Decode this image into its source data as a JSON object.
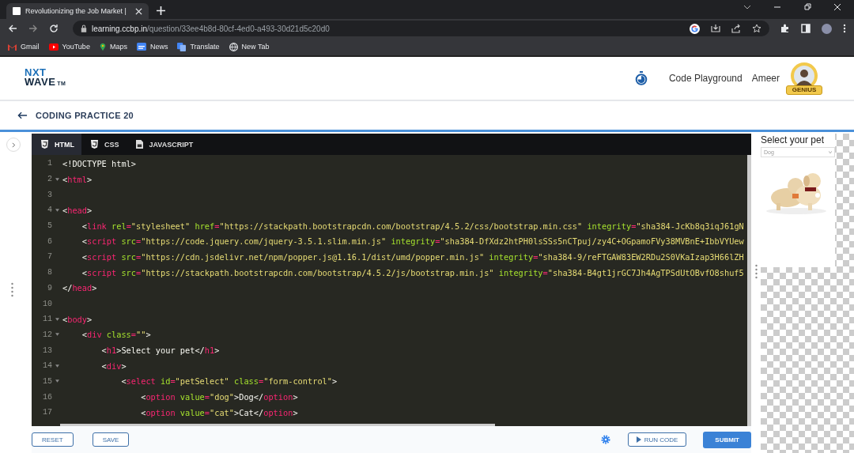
{
  "browser": {
    "tab_title": "Revolutionizing the Job Market |",
    "url_host": "learning.ccbp.in",
    "url_path": "/question/33ee4b8d-80cf-4ed0-a493-30d21d5c20d0",
    "bookmarks": [
      {
        "kind": "gmail",
        "label": "Gmail"
      },
      {
        "kind": "youtube",
        "label": "YouTube"
      },
      {
        "kind": "maps",
        "label": "Maps"
      },
      {
        "kind": "news",
        "label": "News"
      },
      {
        "kind": "translate",
        "label": "Translate"
      },
      {
        "kind": "globe",
        "label": "New Tab"
      }
    ]
  },
  "header": {
    "logo_top": "NXT",
    "logo_bottom": "WAVE",
    "logo_mark": "TM",
    "nav_link": "Code Playground",
    "user_name": "Ameer",
    "badge": "GENIUS"
  },
  "subheader": {
    "title": "CODING PRACTICE 20"
  },
  "editor": {
    "tabs": [
      {
        "label": "HTML",
        "kind": "html",
        "selected": true
      },
      {
        "label": "CSS",
        "kind": "css",
        "selected": false
      },
      {
        "label": "JAVASCRIPT",
        "kind": "js",
        "selected": false
      }
    ],
    "lines": [
      {
        "number": "1",
        "foldable": false,
        "tokens": [
          {
            "kind": "plain",
            "text": "<!DOCTYPE html>"
          }
        ]
      },
      {
        "number": "2",
        "foldable": true,
        "tokens": [
          {
            "kind": "plain",
            "text": "<"
          },
          {
            "kind": "tag",
            "text": "html"
          },
          {
            "kind": "plain",
            "text": ">"
          }
        ]
      },
      {
        "number": "3",
        "foldable": false
      },
      {
        "number": "4",
        "foldable": true,
        "tokens": [
          {
            "kind": "plain",
            "text": "<"
          },
          {
            "kind": "tag",
            "text": "head"
          },
          {
            "kind": "plain",
            "text": ">"
          }
        ]
      },
      {
        "number": "5",
        "foldable": false,
        "tokens": [
          {
            "kind": "plain",
            "text": "    <"
          },
          {
            "kind": "tag",
            "text": "link"
          },
          {
            "kind": "attr",
            "text": " rel"
          },
          {
            "kind": "eq",
            "text": "="
          },
          {
            "kind": "str",
            "text": "\"stylesheet\""
          },
          {
            "kind": "attr",
            "text": " href"
          },
          {
            "kind": "eq",
            "text": "="
          },
          {
            "kind": "str",
            "text": "\"https://stackpath.bootstrapcdn.com/bootstrap/4.5.2/css/bootstrap.min.css\""
          },
          {
            "kind": "attr",
            "text": " integrity"
          },
          {
            "kind": "eq",
            "text": "="
          },
          {
            "kind": "str",
            "text": "\"sha384-JcKb8q3iqJ61gN"
          }
        ]
      },
      {
        "number": "6",
        "foldable": false,
        "tokens": [
          {
            "kind": "plain",
            "text": "    <"
          },
          {
            "kind": "tag",
            "text": "script"
          },
          {
            "kind": "attr",
            "text": " src"
          },
          {
            "kind": "eq",
            "text": "="
          },
          {
            "kind": "str",
            "text": "\"https://code.jquery.com/jquery-3.5.1.slim.min.js\""
          },
          {
            "kind": "attr",
            "text": " integrity"
          },
          {
            "kind": "eq",
            "text": "="
          },
          {
            "kind": "str",
            "text": "\"sha384-DfXdz2htPH0lsSSs5nCTpuj/zy4C+OGpamoFVy38MVBnE+IbbVYUew"
          }
        ]
      },
      {
        "number": "7",
        "foldable": false,
        "tokens": [
          {
            "kind": "plain",
            "text": "    <"
          },
          {
            "kind": "tag",
            "text": "script"
          },
          {
            "kind": "attr",
            "text": " src"
          },
          {
            "kind": "eq",
            "text": "="
          },
          {
            "kind": "str",
            "text": "\"https://cdn.jsdelivr.net/npm/popper.js@1.16.1/dist/umd/popper.min.js\""
          },
          {
            "kind": "attr",
            "text": " integrity"
          },
          {
            "kind": "eq",
            "text": "="
          },
          {
            "kind": "str",
            "text": "\"sha384-9/reFTGAW83EW2RDu2S0VKaIzap3H66lZH"
          }
        ]
      },
      {
        "number": "8",
        "foldable": false,
        "tokens": [
          {
            "kind": "plain",
            "text": "    <"
          },
          {
            "kind": "tag",
            "text": "script"
          },
          {
            "kind": "attr",
            "text": " src"
          },
          {
            "kind": "eq",
            "text": "="
          },
          {
            "kind": "str",
            "text": "\"https://stackpath.bootstrapcdn.com/bootstrap/4.5.2/js/bootstrap.min.js\""
          },
          {
            "kind": "attr",
            "text": " integrity"
          },
          {
            "kind": "eq",
            "text": "="
          },
          {
            "kind": "str",
            "text": "\"sha384-B4gt1jrGC7Jh4AgTPSdUtOBvfO8shuf5"
          }
        ]
      },
      {
        "number": "9",
        "foldable": false,
        "tokens": [
          {
            "kind": "plain",
            "text": "</"
          },
          {
            "kind": "tag",
            "text": "head"
          },
          {
            "kind": "plain",
            "text": ">"
          }
        ]
      },
      {
        "number": "10",
        "foldable": false
      },
      {
        "number": "11",
        "foldable": true,
        "tokens": [
          {
            "kind": "plain",
            "text": "<"
          },
          {
            "kind": "tag",
            "text": "body"
          },
          {
            "kind": "plain",
            "text": ">"
          }
        ]
      },
      {
        "number": "12",
        "foldable": true,
        "tokens": [
          {
            "kind": "plain",
            "text": "    <"
          },
          {
            "kind": "tag",
            "text": "div"
          },
          {
            "kind": "attr",
            "text": " class"
          },
          {
            "kind": "eq",
            "text": "="
          },
          {
            "kind": "str",
            "text": "\"\""
          },
          {
            "kind": "plain",
            "text": ">"
          }
        ]
      },
      {
        "number": "13",
        "foldable": false,
        "tokens": [
          {
            "kind": "plain",
            "text": "        <"
          },
          {
            "kind": "tag",
            "text": "h1"
          },
          {
            "kind": "plain",
            "text": ">Select your pet</"
          },
          {
            "kind": "tag",
            "text": "h1"
          },
          {
            "kind": "plain",
            "text": ">"
          }
        ]
      },
      {
        "number": "14",
        "foldable": true,
        "tokens": [
          {
            "kind": "plain",
            "text": "        <"
          },
          {
            "kind": "tag",
            "text": "div"
          },
          {
            "kind": "plain",
            "text": ">"
          }
        ]
      },
      {
        "number": "15",
        "foldable": true,
        "tokens": [
          {
            "kind": "plain",
            "text": "            <"
          },
          {
            "kind": "tag",
            "text": "select"
          },
          {
            "kind": "attr",
            "text": " id"
          },
          {
            "kind": "eq",
            "text": "="
          },
          {
            "kind": "str",
            "text": "\"petSelect\""
          },
          {
            "kind": "attr",
            "text": " class"
          },
          {
            "kind": "eq",
            "text": "="
          },
          {
            "kind": "str",
            "text": "\"form-control\""
          },
          {
            "kind": "plain",
            "text": ">"
          }
        ]
      },
      {
        "number": "16",
        "foldable": false,
        "tokens": [
          {
            "kind": "plain",
            "text": "                <"
          },
          {
            "kind": "tag",
            "text": "option"
          },
          {
            "kind": "attr",
            "text": " value"
          },
          {
            "kind": "eq",
            "text": "="
          },
          {
            "kind": "str",
            "text": "\"dog\""
          },
          {
            "kind": "plain",
            "text": ">Dog</"
          },
          {
            "kind": "tag",
            "text": "option"
          },
          {
            "kind": "plain",
            "text": ">"
          }
        ]
      },
      {
        "number": "17",
        "foldable": false,
        "tokens": [
          {
            "kind": "plain",
            "text": "                <"
          },
          {
            "kind": "tag",
            "text": "option"
          },
          {
            "kind": "attr",
            "text": " value"
          },
          {
            "kind": "eq",
            "text": "="
          },
          {
            "kind": "str",
            "text": "\"cat\""
          },
          {
            "kind": "plain",
            "text": ">Cat</"
          },
          {
            "kind": "tag",
            "text": "option"
          },
          {
            "kind": "plain",
            "text": ">"
          }
        ]
      }
    ]
  },
  "preview": {
    "heading": "Select your pet",
    "select_value": "Dog"
  },
  "footer": {
    "reset": "RESET",
    "save": "SAVE",
    "run": "RUN CODE",
    "submit": "SUBMIT"
  }
}
